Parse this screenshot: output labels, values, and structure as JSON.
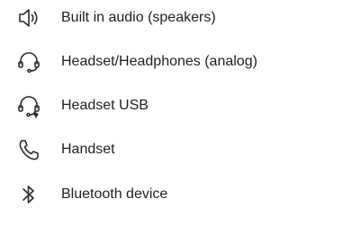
{
  "devices": [
    {
      "label": "Built in audio (speakers)",
      "icon": "speaker-icon"
    },
    {
      "label": "Headset/Headphones (analog)",
      "icon": "headset-analog-icon"
    },
    {
      "label": "Headset USB",
      "icon": "headset-usb-icon"
    },
    {
      "label": "Handset",
      "icon": "handset-icon"
    },
    {
      "label": "Bluetooth device",
      "icon": "bluetooth-icon"
    }
  ],
  "colors": {
    "text": "#1f1f1f",
    "icon": "#2a2a2a",
    "background": "#ffffff"
  }
}
